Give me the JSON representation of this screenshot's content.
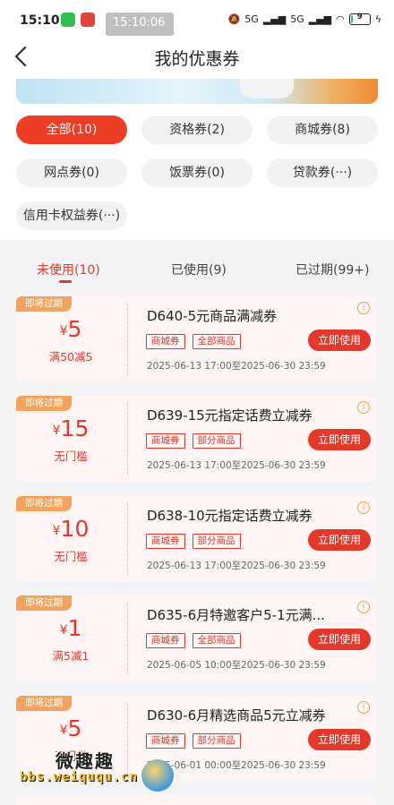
{
  "status_bar": {
    "time": "15:10",
    "overlay_time": "15:10:06",
    "network": "5G",
    "battery": "9"
  },
  "header": {
    "title": "我的优惠券"
  },
  "filters": [
    {
      "label": "全部(10)",
      "active": true
    },
    {
      "label": "资格券(2)",
      "active": false
    },
    {
      "label": "商城券(8)",
      "active": false
    },
    {
      "label": "网点券(0)",
      "active": false
    },
    {
      "label": "饭票券(0)",
      "active": false
    },
    {
      "label": "贷款券(···)",
      "active": false
    },
    {
      "label": "信用卡权益券(···)",
      "active": false
    }
  ],
  "tabs": [
    {
      "label": "未使用(10)",
      "active": true
    },
    {
      "label": "已使用(9)",
      "active": false
    },
    {
      "label": "已过期(99+)",
      "active": false
    }
  ],
  "coupons": [
    {
      "badge": "即将过期",
      "currency": "¥",
      "amount": "5",
      "condition": "满50减5",
      "title": "D640-5元商品满减券",
      "tags": [
        "商城券",
        "全部商品"
      ],
      "action": "立即使用",
      "date": "2025-06-13 17:00至2025-06-30 23:59"
    },
    {
      "badge": "即将过期",
      "currency": "¥",
      "amount": "15",
      "condition": "无门槛",
      "title": "D639-15元指定话费立减券",
      "tags": [
        "商城券",
        "部分商品"
      ],
      "action": "立即使用",
      "date": "2025-06-13 17:00至2025-06-30 23:59"
    },
    {
      "badge": "即将过期",
      "currency": "¥",
      "amount": "10",
      "condition": "无门槛",
      "title": "D638-10元指定话费立减券",
      "tags": [
        "商城券",
        "部分商品"
      ],
      "action": "立即使用",
      "date": "2025-06-13 17:00至2025-06-30 23:59"
    },
    {
      "badge": "即将过期",
      "currency": "¥",
      "amount": "1",
      "condition": "满5减1",
      "title": "D635-6月特邀客户5-1元满...",
      "tags": [
        "商城券",
        "全部商品"
      ],
      "action": "立即使用",
      "date": "2025-06-05 10:00至2025-06-30 23:59"
    },
    {
      "badge": "即将过期",
      "currency": "¥",
      "amount": "5",
      "condition": "无门槛",
      "title": "D630-6月精选商品5元立减券",
      "tags": [
        "商城券",
        "部分商品"
      ],
      "action": "立即使用",
      "date": "2025-06-01 00:00至2025-06-30 23:59"
    }
  ],
  "watermark": {
    "text": "微趣趣",
    "url": "bbs.weiququ.cn"
  },
  "info_icon": "info-icon",
  "colors": {
    "accent": "#e3382a",
    "badge": "#f4a35d",
    "card_bg": "#fff5f4"
  }
}
